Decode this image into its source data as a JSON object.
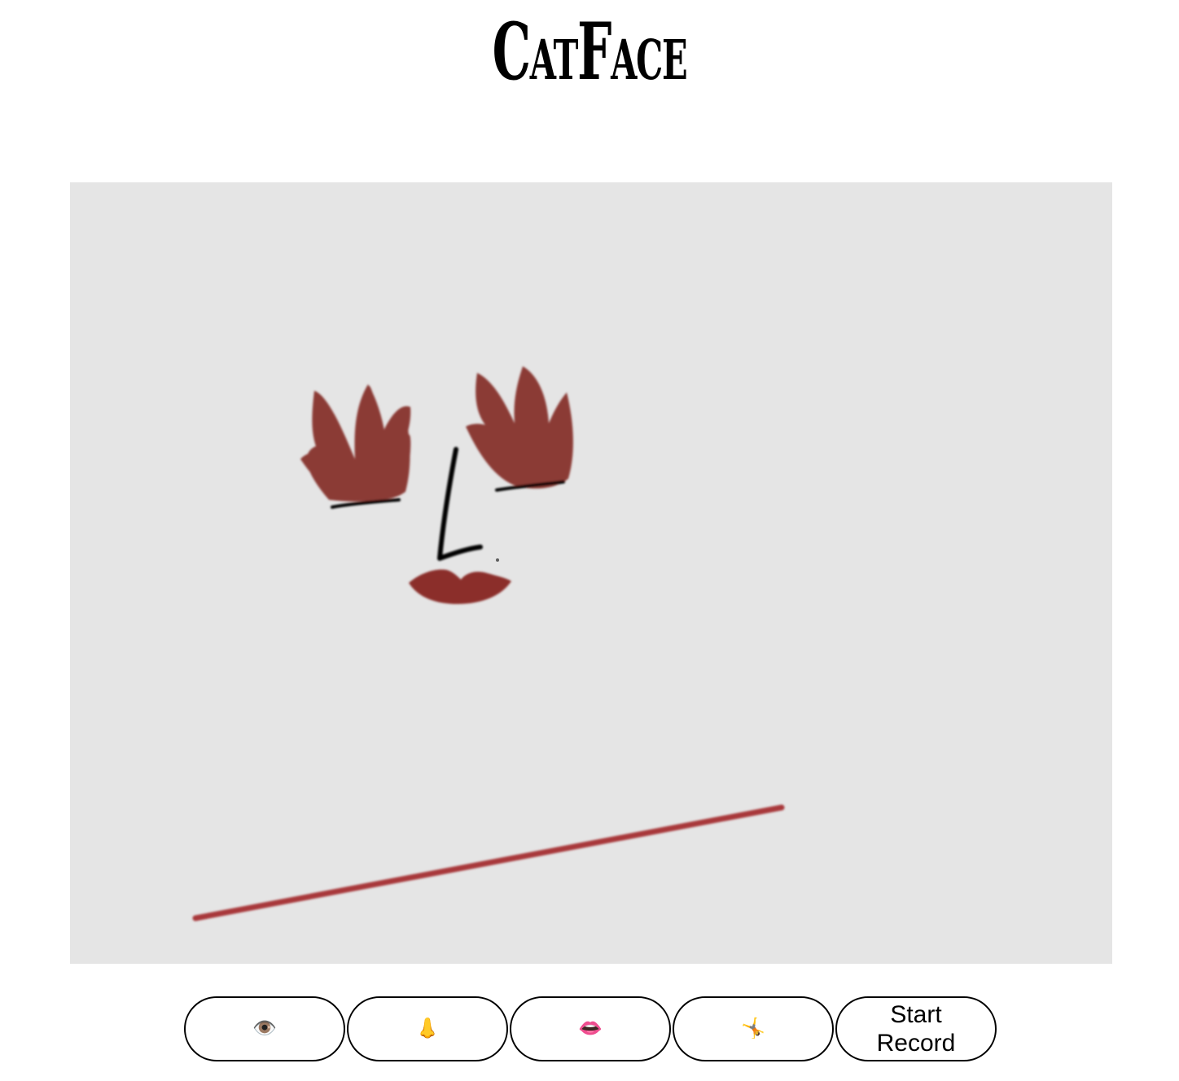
{
  "app": {
    "title": "CatFace"
  },
  "canvas": {
    "background": "#e5e5e5",
    "brush_color": "#8b3a36",
    "line_color": "#000000",
    "stroke_color": "#a8383a"
  },
  "toolbar": {
    "buttons": [
      {
        "icon": "eye-icon",
        "glyph": "👁️"
      },
      {
        "icon": "nose-icon",
        "glyph": "👃"
      },
      {
        "icon": "lips-icon",
        "glyph": "👄"
      },
      {
        "icon": "cartwheel-icon",
        "glyph": "🤸"
      }
    ],
    "record_label": "Start Record"
  }
}
